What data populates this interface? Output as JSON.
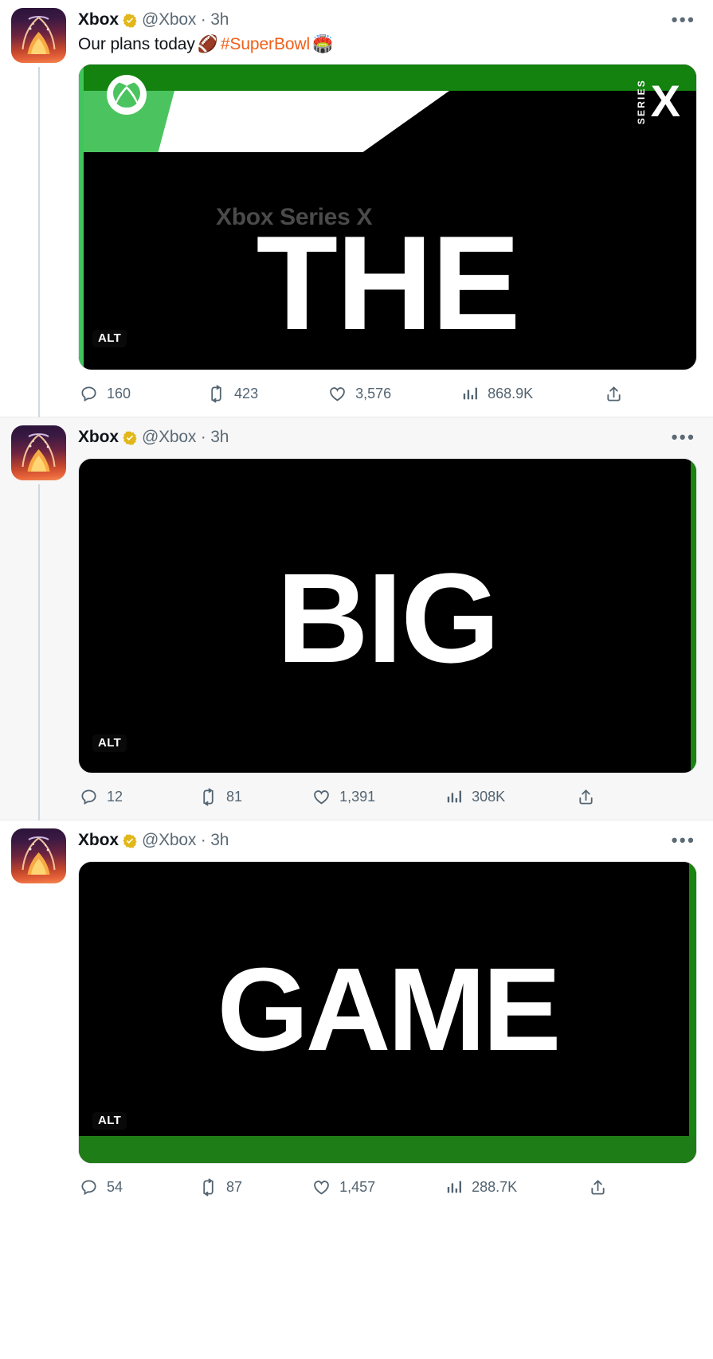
{
  "account": {
    "display_name": "Xbox",
    "handle": "@Xbox",
    "verified_badge": "verified-gold-icon",
    "avatar": "xbox-logo-avatar"
  },
  "tweets": [
    {
      "display_name": "Xbox",
      "handle": "@Xbox",
      "separator": "·",
      "timestamp": "3h",
      "more_label": "•••",
      "body": {
        "text_before": "Our plans today",
        "football_emoji": "🏈",
        "hashtag": "#SuperBowl",
        "stadium_emoji": "🏟️"
      },
      "media": {
        "alt_badge": "ALT",
        "word": "THE",
        "brand_title": "Xbox Series X",
        "series_label": "SERIES",
        "series_mark": "X",
        "xbox_logo": "xbox-sphere-icon"
      },
      "actions": {
        "reply_label": "160",
        "retweet_label": "423",
        "like_label": "3,576",
        "views_label": "868.9K",
        "share_label": ""
      }
    },
    {
      "display_name": "Xbox",
      "handle": "@Xbox",
      "separator": "·",
      "timestamp": "3h",
      "more_label": "•••",
      "media": {
        "alt_badge": "ALT",
        "word": "BIG"
      },
      "actions": {
        "reply_label": "12",
        "retweet_label": "81",
        "like_label": "1,391",
        "views_label": "308K",
        "share_label": ""
      }
    },
    {
      "display_name": "Xbox",
      "handle": "@Xbox",
      "separator": "·",
      "timestamp": "3h",
      "more_label": "•••",
      "media": {
        "alt_badge": "ALT",
        "word": "GAME"
      },
      "actions": {
        "reply_label": "54",
        "retweet_label": "87",
        "like_label": "1,457",
        "views_label": "288.7K",
        "share_label": ""
      }
    }
  ],
  "colors": {
    "xbox_green": "#107C10",
    "xbox_green_bright": "#3EC65A",
    "hashtag_orange": "#F0601A",
    "verified_gold": "#E2B719",
    "text_primary": "#0F1419",
    "text_secondary": "#536471",
    "page_background": "#FFFFFF",
    "alt_row_background": "#F7F7F8"
  }
}
